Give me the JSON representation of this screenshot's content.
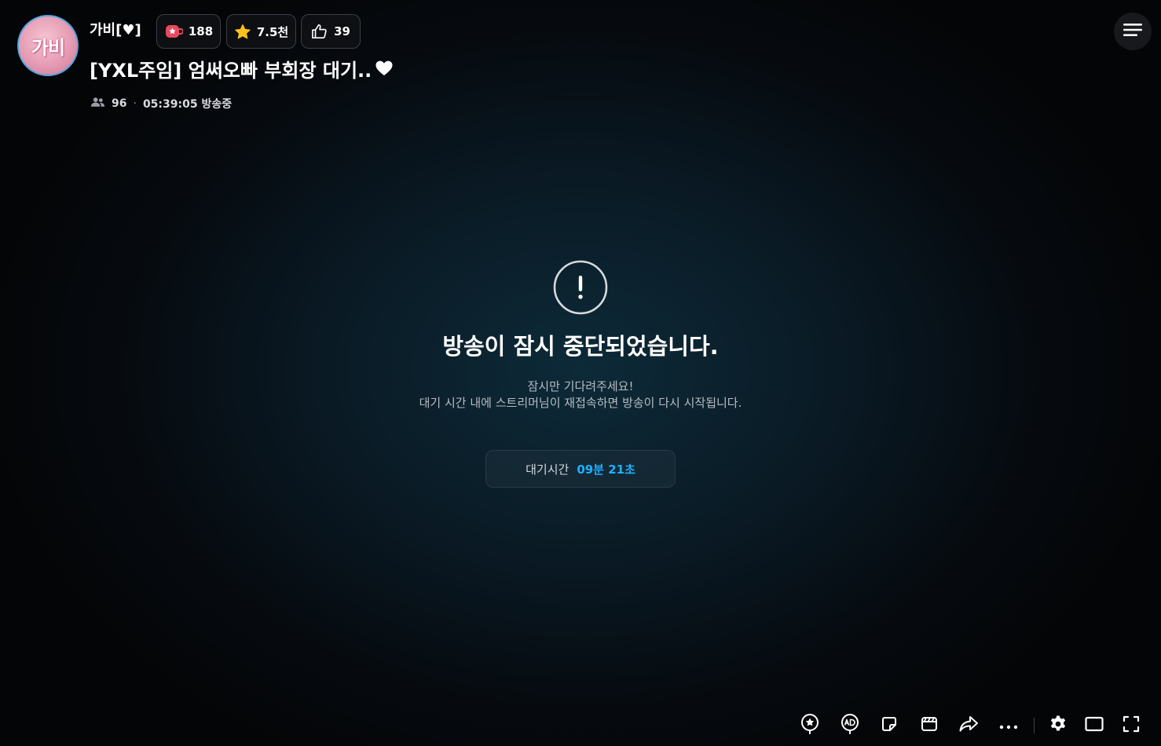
{
  "header": {
    "avatar_text": "가비",
    "streamer_name": "가비[♥]",
    "fan_count": "188",
    "star_count": "7.5천",
    "like_count": "39",
    "title": "[YXL주임] 엄써오빠 부회장 대기..",
    "viewer_count": "96",
    "separator": "·",
    "elapsed": "05:39:05 방송중"
  },
  "colors": {
    "accent_blue": "#1fb0ff",
    "fan_red": "#e84a5f",
    "star_yellow": "#ffc21a"
  },
  "icons": {
    "fan": "fan-badge-icon",
    "star": "star-icon",
    "like": "thumbs-up-icon",
    "viewers": "viewers-icon",
    "menu": "hamburger-menu-icon",
    "alert": "exclamation-circle-icon"
  },
  "message": {
    "headline": "방송이 잠시 중단되었습니다.",
    "line1": "잠시만 기다려주세요!",
    "line2": "대기 시간 내에 스트리머님이 재접속하면 방송이 다시 시작됩니다.",
    "wait_label": "대기시간",
    "wait_time": "09분 21초"
  },
  "toolbar": {
    "items": [
      "star-balloon-icon",
      "ad-balloon-icon",
      "sticker-icon",
      "clip-icon",
      "share-icon",
      "more-icon",
      "settings-icon",
      "theater-mode-icon",
      "fullscreen-icon"
    ]
  }
}
